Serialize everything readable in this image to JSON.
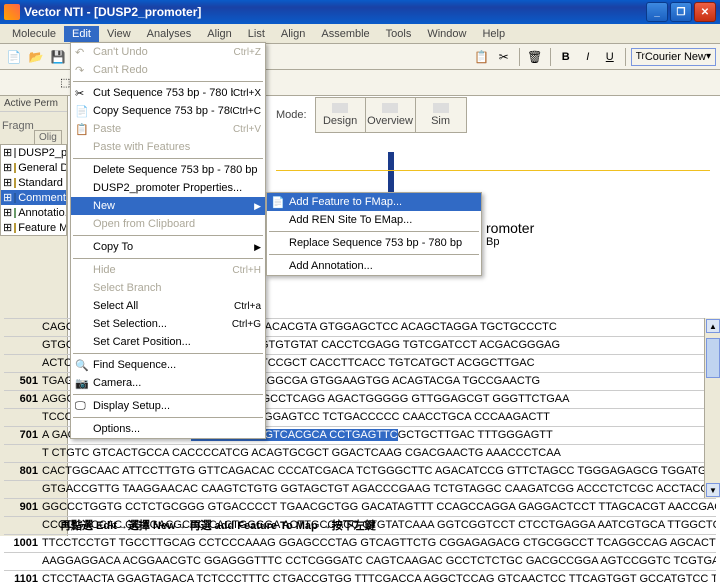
{
  "window": {
    "title": "Vector NTI - [DUSP2_promoter]"
  },
  "menubar": {
    "items": [
      "Molecule",
      "Edit",
      "View",
      "Analyses",
      "Align",
      "List",
      "Align",
      "Assemble",
      "Tools",
      "Window",
      "Help"
    ],
    "active": 1
  },
  "edit_menu": {
    "items": [
      {
        "icon": "↶",
        "label": "Can't Undo",
        "shortcut": "Ctrl+Z",
        "enabled": false
      },
      {
        "icon": "↷",
        "label": "Can't Redo",
        "shortcut": "",
        "enabled": false
      },
      {
        "sep": true
      },
      {
        "icon": "✂",
        "label": "Cut Sequence 753 bp - 780 bp",
        "shortcut": "Ctrl+X",
        "enabled": true
      },
      {
        "icon": "📄",
        "label": "Copy Sequence 753 bp - 780 bp",
        "shortcut": "Ctrl+C",
        "enabled": true
      },
      {
        "icon": "📋",
        "label": "Paste",
        "shortcut": "Ctrl+V",
        "enabled": false
      },
      {
        "icon": "",
        "label": "Paste with Features",
        "shortcut": "",
        "enabled": false
      },
      {
        "sep": true
      },
      {
        "icon": "",
        "label": "Delete Sequence 753 bp - 780 bp",
        "shortcut": "",
        "enabled": true
      },
      {
        "icon": "",
        "label": "DUSP2_promoter Properties...",
        "shortcut": "",
        "enabled": true
      },
      {
        "icon": "",
        "label": "New",
        "shortcut": "",
        "enabled": true,
        "hl": true,
        "submenu": true
      },
      {
        "icon": "",
        "label": "Open from Clipboard",
        "shortcut": "",
        "enabled": false
      },
      {
        "sep": true
      },
      {
        "icon": "",
        "label": "Copy To",
        "shortcut": "",
        "enabled": true,
        "submenu": true
      },
      {
        "sep": true
      },
      {
        "icon": "",
        "label": "Hide",
        "shortcut": "Ctrl+H",
        "enabled": false
      },
      {
        "icon": "",
        "label": "Select Branch",
        "shortcut": "",
        "enabled": false
      },
      {
        "icon": "",
        "label": "Select All",
        "shortcut": "Ctrl+a",
        "enabled": true
      },
      {
        "icon": "",
        "label": "Set Selection...",
        "shortcut": "Ctrl+G",
        "enabled": true
      },
      {
        "icon": "",
        "label": "Set Caret Position...",
        "shortcut": "",
        "enabled": true
      },
      {
        "sep": true
      },
      {
        "icon": "🔍",
        "label": "Find Sequence...",
        "shortcut": "",
        "enabled": true
      },
      {
        "icon": "📷",
        "label": "Camera...",
        "shortcut": "",
        "enabled": true
      },
      {
        "sep": true
      },
      {
        "icon": "🖵",
        "label": "Display Setup...",
        "shortcut": "",
        "enabled": true
      },
      {
        "sep": true
      },
      {
        "icon": "",
        "label": "Options...",
        "shortcut": "",
        "enabled": true
      }
    ]
  },
  "new_submenu": {
    "items": [
      {
        "icon": "📄",
        "label": "Add Feature to FMap...",
        "hl": true
      },
      {
        "icon": "",
        "label": "Add REN Site To EMap..."
      },
      {
        "sep": true
      },
      {
        "icon": "",
        "label": "Replace Sequence 753 bp - 780 bp"
      },
      {
        "sep": true
      },
      {
        "icon": "",
        "label": "Add Annotation..."
      }
    ]
  },
  "leftpanel": {
    "label": "Active Perm",
    "tab": "Olig",
    "prepend": "Fragments",
    "tree": [
      {
        "icon": "doc",
        "label": "DUSP2_p..."
      },
      {
        "icon": "folder",
        "label": "General D..."
      },
      {
        "icon": "folder",
        "label": "Standard I..."
      },
      {
        "icon": "blue",
        "label": "Comments",
        "sel": true
      },
      {
        "icon": "note",
        "label": "Annotatio..."
      },
      {
        "icon": "folder",
        "label": "Feature M..."
      }
    ]
  },
  "modebar": {
    "label": "Mode:",
    "items": [
      "Design",
      "Overview",
      "Sim"
    ]
  },
  "rightinfo": {
    "name": "romoter",
    "size": "Bp"
  },
  "toolbar": {
    "font": "Courier New"
  },
  "sequence": {
    "rows": [
      {
        "num": "",
        "seq": "                                        CAGCA CACACAAGCT CCAGGTCCTT CTCACACGTA GTGGAGCTCC ACAGCTAGGA TGCTGCCCTC"
      },
      {
        "num": "",
        "seq": "                                  GTGGT GTGTGTTCGA GGTCCAGGAA GAGTGTGTAT CACCTCGAGG TGTCGATCCT ACGACGGGAG"
      },
      {
        "num": "",
        "seq": "                                        ACTCA GGCACATAGA CTCCATAAGC GGATCCGCT CACCTTCACC TGTCATGCT ACGGCTTGAC"
      },
      {
        "num": "501",
        "seq": "                                        TGAGT CCGTGTATCT GAGGTATTCG CCTAGGCGA GTGGAAGTGG ACAGTACGA TGCCGAACTG"
      },
      {
        "num": "601",
        "seq": "                                        AGGGT CTTCTGAGAG GCACGGATGA GGGCCTCAGG AGACTGGGGG GTTGGAGCGT GGGTTCTGAA"
      },
      {
        "num": "",
        "seq": "                                        TCCCA GAAGACTCTC CGTGCCTACT CCCGGAGTCC TCTGACCCCC CAACCTGCA CCCAAGACTT"
      },
      {
        "num": "701",
        "seq": "A                                       GACAG CAGTGACGGT GT",
        "hl": "GGGGTAGC TGTCACGCA CCTGAGTTC",
        "tail": "GCTGCTTGAC TTTGGGAGTT"
      },
      {
        "num": "",
        "seq": "T                                       CTGTC GTCACTGCCA CACCCCATCG ACAGTGCGCT GGACTCAAG CGACGAACTG AAACCCTCAA"
      },
      {
        "num": "801",
        "seq": "CACTGGCAAC ATTCCTTGTG GTTCAGACAC CCCATCGACA TCTGGGCTTC AGACATCCG GTTCTAGCC TGGGAGAGCG TGGATGCCG GGCATAACCA"
      },
      {
        "num": "",
        "seq": "GTGACCGTTG TAAGGAACAC CAAGTCTGTG GGTAGCTGT AGACCCGAAG TCTGTAGGC CAAGATCGG ACCCTCTCGC ACCTACGGC CCGTATTGGT"
      },
      {
        "num": "901",
        "seq": "GGCCCTGGTG CCTCTGCGGG GTGACCCCT TGAACGCTGG GACATAGTTT CCAGCCAGGA GAGGACTCCT TTAGCACGT AACCGAGGA TGTCTATCCG"
      },
      {
        "num": "",
        "seq": "CCGGGACCAC GGAGACGCCC CACTGGGGA ACTTGCGACC CTGTATCAAA GGTCGGTCCT CTCCTGAGGA AATCGTGCA TTGGCTCCT ACAGATAGGC"
      },
      {
        "num": "1001",
        "seq": "TTCCTCCTGT TGCCTTGCAG CCTCCCAAAG GGAGCCCTAG GTCAGTTCTG CGGAGAGACG CTGCGGCCT TCAGGCCAG AGCACTGAG CGGATAGCGG"
      },
      {
        "num": "",
        "seq": "AAGGAGGACA ACGGAACGTC GGAGGGTTTC CCTCGGGATC CAGTCAAGAC GCCTCTCTGC GACGCCGGA AGTCCGGTC TCGTGACTC GCCTATCGCC"
      },
      {
        "num": "1101",
        "seq": "CTCCTAACTA GGAGTAGACA TCTCCCTTTC CTGACCGTGG TTTCGACCA AGGCTCCAG GTCAACTCC TTCAGTGGT GCCATGTCC TTCAACCGC"
      }
    ]
  },
  "bottom": {
    "text_parts": [
      "再點選 Edit",
      "選擇 New",
      " 再選 add Feature To Map ",
      "按下左鍵"
    ]
  }
}
